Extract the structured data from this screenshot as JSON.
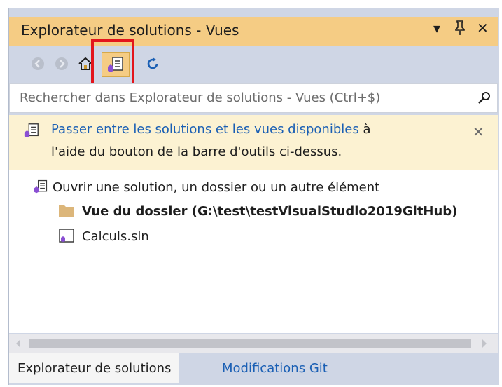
{
  "window": {
    "title": "Explorateur de solutions - Vues",
    "controls": {
      "dropdown": "▾",
      "pin": "⬍",
      "close": "✕"
    }
  },
  "toolbar": {
    "buttons": [
      {
        "icon": "back-arrow-icon",
        "enabled": false
      },
      {
        "icon": "forward-arrow-icon",
        "enabled": false
      },
      {
        "icon": "home-icon",
        "enabled": true
      },
      {
        "icon": "switch-views-icon",
        "enabled": true,
        "highlighted": true
      },
      {
        "icon": "refresh-icon",
        "enabled": true
      }
    ]
  },
  "search": {
    "placeholder": "Rechercher dans Explorateur de solutions - Vues (Ctrl+$)",
    "icon": "search-icon"
  },
  "info": {
    "link_text": "Passer entre les solutions et les vues disponibles",
    "text_after_link": " à",
    "line2": "l'aide du bouton de la barre d'outils ci-dessus.",
    "close": "✕"
  },
  "tree": {
    "items": [
      {
        "label": "Ouvrir une solution, un dossier ou un autre élément",
        "icon": "solution-icon",
        "bold": false
      },
      {
        "label": "Vue du dossier (G:\\test\\testVisualStudio2019GitHub)",
        "icon": "folder-icon",
        "bold": true
      },
      {
        "label": "Calculs.sln",
        "icon": "sln-file-icon",
        "bold": false
      }
    ]
  },
  "tabs": [
    {
      "label": "Explorateur de solutions",
      "active": true
    },
    {
      "label": "Modifications Git",
      "active": false
    }
  ],
  "colors": {
    "title_bg": "#f5cc84",
    "toolbar_bg": "#cfd6e5",
    "info_bg": "#fcf2d2",
    "link": "#1a5fb4",
    "highlight_border": "#e3151c"
  }
}
